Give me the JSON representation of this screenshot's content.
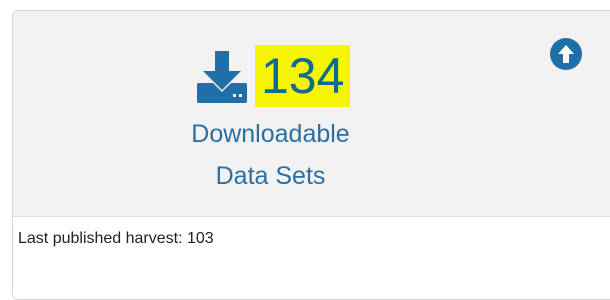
{
  "card": {
    "count": "134",
    "label_line1": "Downloadable",
    "label_line2": "Data Sets",
    "footer_text": "Last published harvest: 103"
  },
  "icons": {
    "download": "download-icon",
    "collapse": "arrow-circle-up-icon"
  },
  "colors": {
    "accent": "#1f6fa8",
    "highlight": "#f5f500",
    "label": "#2a6fa6"
  }
}
